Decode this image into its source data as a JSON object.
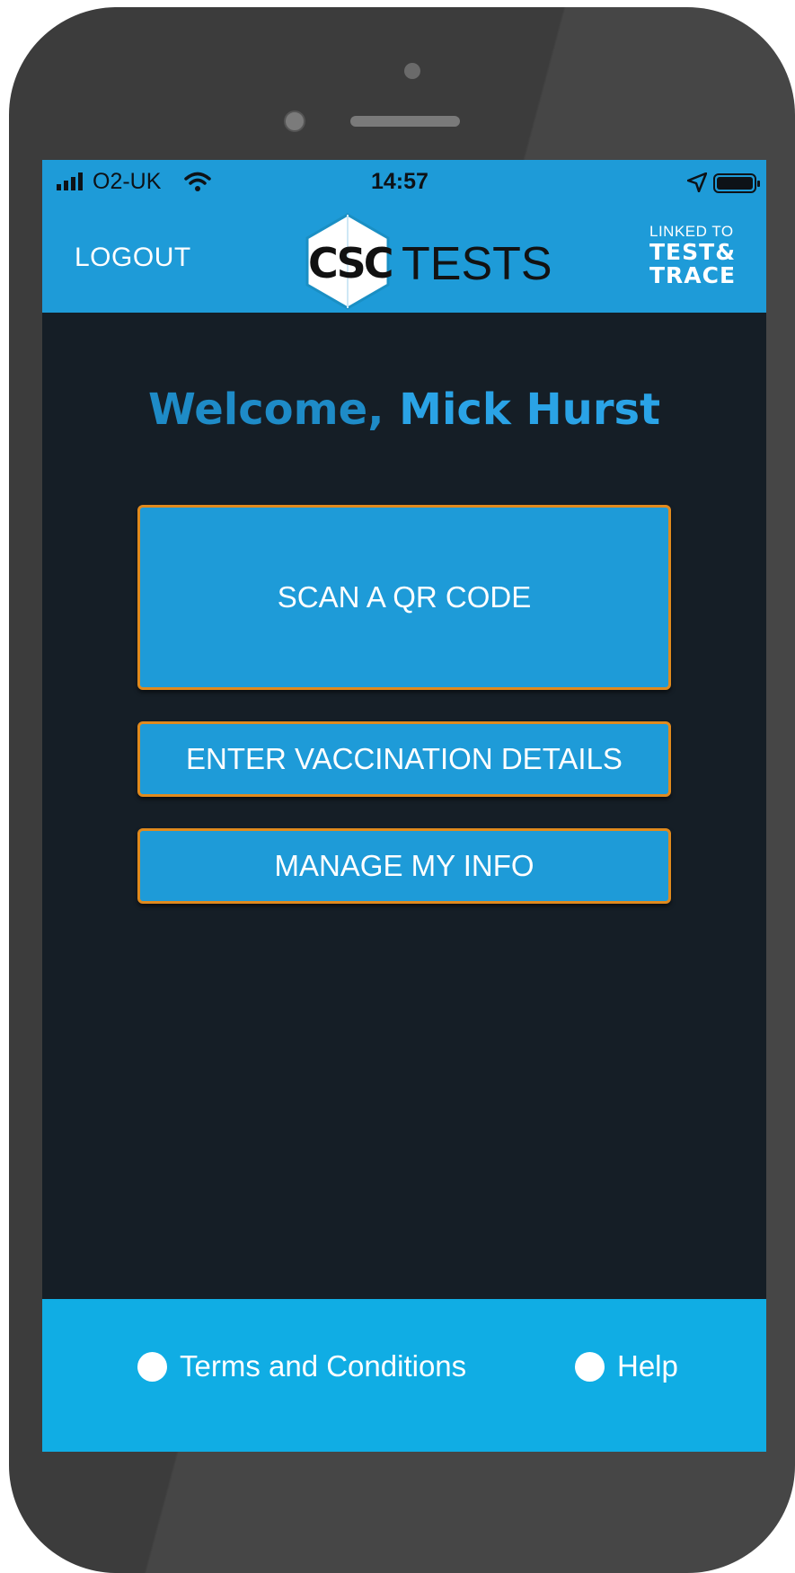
{
  "status_bar": {
    "carrier": "O2-UK",
    "time": "14:57",
    "icons": [
      "signal-icon",
      "wifi-icon",
      "location-arrow-icon",
      "battery-icon"
    ]
  },
  "header": {
    "logout_label": "LOGOUT",
    "logo_csc": "CSC",
    "logo_tests": "TESTS",
    "linked_small": "LINKED TO",
    "linked_line1": "TEST&",
    "linked_line2": "TRACE"
  },
  "welcome": {
    "greeting": "Welcome,",
    "name": "Mick Hurst"
  },
  "actions": {
    "scan_label": "SCAN A QR CODE",
    "vaccination_label": "ENTER VACCINATION DETAILS",
    "info_label": "MANAGE MY INFO"
  },
  "footer": {
    "terms_label": "Terms and Conditions",
    "help_label": "Help"
  },
  "colors": {
    "brand_blue": "#1e9bd8",
    "footer_blue": "#10ade4",
    "button_border": "#e08a1e",
    "background": "#151e26"
  }
}
